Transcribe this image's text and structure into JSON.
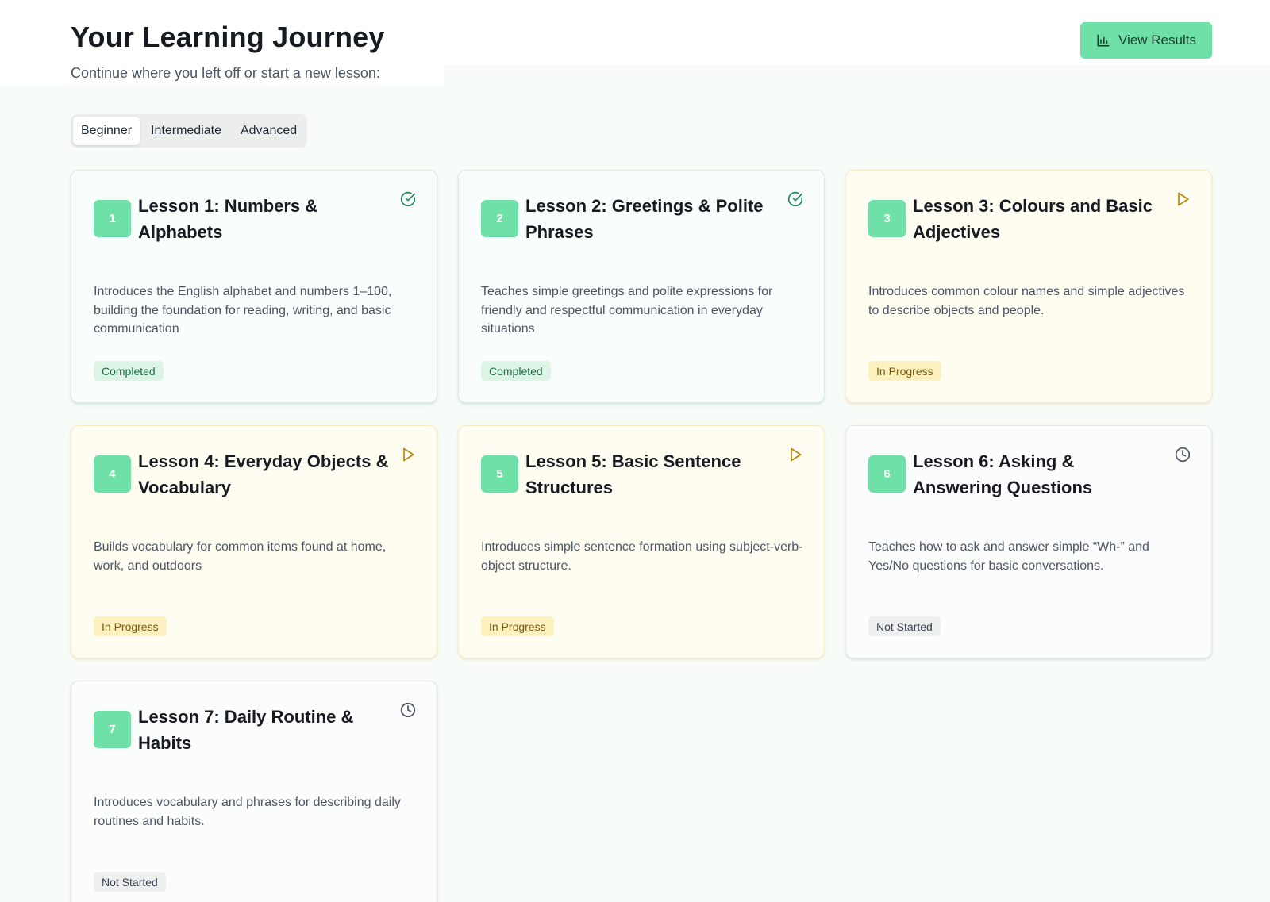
{
  "header": {
    "title": "Your Learning Journey",
    "subtitle": "Continue where you left off or start a new lesson:",
    "view_results_label": "View Results"
  },
  "tabs": [
    {
      "label": "Beginner",
      "active": true
    },
    {
      "label": "Intermediate",
      "active": false
    },
    {
      "label": "Advanced",
      "active": false
    }
  ],
  "colors": {
    "accent": "#6ee0a8",
    "completed": "#1d6b42",
    "in_progress": "#b8860b",
    "not_started": "#6b7280"
  },
  "lessons": [
    {
      "number": "1",
      "title": "Lesson 1: Numbers & Alphabets",
      "description": "Introduces the English alphabet and numbers 1–100, building the foundation for reading, writing, and basic communication",
      "status": "Completed",
      "icon": "check-circle-icon"
    },
    {
      "number": "2",
      "title": "Lesson 2: Greetings & Polite Phrases",
      "description": "Teaches simple greetings and polite expressions for friendly and respectful communication in everyday situations",
      "status": "Completed",
      "icon": "check-circle-icon"
    },
    {
      "number": "3",
      "title": "Lesson 3: Colours and Basic Adjectives",
      "description": "Introduces common colour names and simple adjectives to describe objects and people.",
      "status": "In Progress",
      "icon": "play-icon"
    },
    {
      "number": "4",
      "title": "Lesson 4: Everyday Objects & Vocabulary",
      "description": "Builds vocabulary for common items found at home, work, and outdoors",
      "status": "In Progress",
      "icon": "play-icon"
    },
    {
      "number": "5",
      "title": "Lesson 5: Basic Sentence Structures",
      "description": "Introduces simple sentence formation using subject-verb-object structure.",
      "status": "In Progress",
      "icon": "play-icon"
    },
    {
      "number": "6",
      "title": "Lesson 6: Asking & Answering Questions",
      "description": "Teaches how to ask and answer simple “Wh-” and Yes/No questions for basic conversations.",
      "status": "Not Started",
      "icon": "clock-icon"
    },
    {
      "number": "7",
      "title": "Lesson 7: Daily Routine & Habits",
      "description": "Introduces vocabulary and phrases for describing daily routines and habits.",
      "status": "Not Started",
      "icon": "clock-icon"
    }
  ]
}
